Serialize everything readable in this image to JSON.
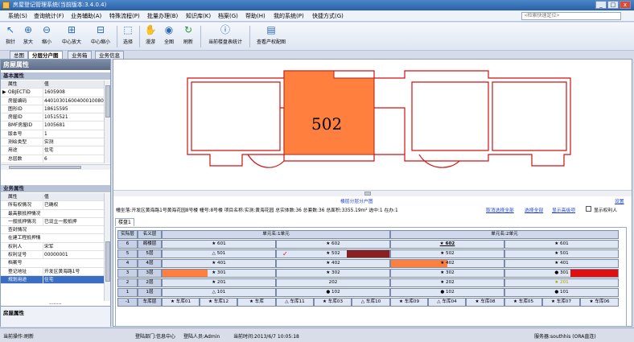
{
  "window": {
    "title": "房屋登记管理系统(当前版本:3.4.0.4)",
    "min": "_",
    "max": "□",
    "close": "x"
  },
  "menu": [
    "系统(S)",
    "查询统计(F)",
    "业务辅助(A)",
    "特殊流程(P)",
    "批量办理(B)",
    "知识库(K)",
    "档案(G)",
    "帮助(H)",
    "我的系统(P)",
    "快捷方式(G)"
  ],
  "search": {
    "placeholder": "<检索快速定位>"
  },
  "toolbar": [
    {
      "label": "指针",
      "icon": "pointer-icon",
      "glyph": "↖"
    },
    {
      "label": "放大",
      "icon": "zoom-in-icon",
      "glyph": "⊕"
    },
    {
      "label": "缩小",
      "icon": "zoom-out-icon",
      "glyph": "⊖"
    },
    {
      "label": "中心放大",
      "icon": "center-zoom-in-icon",
      "glyph": "⊞"
    },
    {
      "label": "中心缩小",
      "icon": "center-zoom-out-icon",
      "glyph": "⊟"
    },
    {
      "label": "选择",
      "icon": "select-icon",
      "glyph": "⬚"
    },
    {
      "label": "漫游",
      "icon": "pan-hand-icon",
      "glyph": "✋"
    },
    {
      "label": "全图",
      "icon": "full-extent-icon",
      "glyph": "◉"
    },
    {
      "label": "刷新",
      "icon": "refresh-icon",
      "glyph": "↻"
    },
    {
      "label": "当前楼盘表统计",
      "icon": "info-icon",
      "glyph": "ⓘ"
    },
    {
      "label": "查看产权配图",
      "icon": "map-icon",
      "glyph": "▤"
    }
  ],
  "tabs": [
    "总图",
    "分层分户图",
    "业务箱",
    "业务信息"
  ],
  "left": {
    "title": "房屋属性",
    "basic_section": "基本属性",
    "basic_header": {
      "k": "属性",
      "v": "值"
    },
    "basic_rows": [
      {
        "k": "OBJECTID",
        "v": "1605908"
      },
      {
        "k": "房屋编码",
        "v": "440103016004000100800"
      },
      {
        "k": "图形ID",
        "v": "18615595"
      },
      {
        "k": "房屋ID",
        "v": "10515521"
      },
      {
        "k": "BMF房屋ID",
        "v": "1005681"
      },
      {
        "k": "版本号",
        "v": "1"
      },
      {
        "k": "测绘类型",
        "v": "实测"
      },
      {
        "k": "用途",
        "v": "住宅"
      },
      {
        "k": "总层数",
        "v": "6"
      }
    ],
    "biz_section": "业务属性",
    "biz_header": {
      "k": "属性",
      "v": "值"
    },
    "biz_rows": [
      {
        "k": "所有权情况",
        "v": "已确权"
      },
      {
        "k": "最高额抵押情况",
        "v": ""
      },
      {
        "k": "一般抵押情况",
        "v": "已设立一般抵押"
      },
      {
        "k": "查封情况",
        "v": ""
      },
      {
        "k": "在建工程抵押情",
        "v": ""
      },
      {
        "k": "权利人",
        "v": "宋军"
      },
      {
        "k": "权利证号",
        "v": "00000001"
      },
      {
        "k": "档案号",
        "v": ""
      },
      {
        "k": "登记地址",
        "v": "开发区黄海路1号"
      },
      {
        "k": "规划用途",
        "v": "住宅"
      }
    ],
    "footer": "房屋属性",
    "dots": "........"
  },
  "plan": {
    "room_label": "502"
  },
  "info": {
    "title": "楼层分层分户图",
    "settings": "设置",
    "summary": "幢坐落:开发区黄海路1号黄海花园8号楼   幢号:8号楼   项目名称:实测:黄海花园  总实体数:36  总套数:36  总面积:3355.19m²  选中:1  在办:1",
    "links": [
      "取消选择全部",
      "选择全部",
      "显示高级项"
    ],
    "checkbox": "显示权利人",
    "sheet_tab": "楼盘1"
  },
  "table": {
    "col_floor": "实际层",
    "col_name": "名义层",
    "unit1": "单元名:1单元",
    "unit2": "单元名:2单元",
    "rows": [
      {
        "f": "6",
        "n": "阁楼层",
        "c": [
          "★ 601",
          "★ 602",
          "★ 602",
          "★ 601"
        ]
      },
      {
        "f": "5",
        "n": "5层",
        "c": [
          "△ 501",
          "★ 502",
          "★ 502",
          "★ 501"
        ]
      },
      {
        "f": "4",
        "n": "4层",
        "c": [
          "★ 401",
          "★ 402",
          "★ 402",
          "★ 401"
        ]
      },
      {
        "f": "3",
        "n": "3层",
        "c": [
          "★ 301",
          "★ 302",
          "★ 302",
          "● 301"
        ]
      },
      {
        "f": "2",
        "n": "2层",
        "c": [
          "★ 201",
          "202",
          "★ 202",
          "★ 201"
        ]
      },
      {
        "f": "1",
        "n": "1层",
        "c": [
          "△ 101",
          "● 102",
          "● 102",
          "● 101"
        ]
      },
      {
        "f": "-1",
        "n": "车库层",
        "c": [
          "★ 车库01",
          "★ 车库12",
          "★ 车库",
          "△ 车库11",
          "★ 车库03",
          "△ 车库10",
          "★ 车库09",
          "△ 车库04",
          "★ 车库08",
          "★ 车库05",
          "★ 车库07",
          "★ 车库06"
        ]
      }
    ]
  },
  "status": {
    "s1": "当前操作:刷新",
    "s2": "登陆部门:信息中心",
    "s3": "登陆人员:Admin",
    "s4": "当前时间:2013/6/7 10:05:18",
    "s5": "服务器:southhis (ORA直连)"
  },
  "colors": {
    "selected": "#ff7f3f",
    "dark_red": "#8b2020",
    "red": "#e01010",
    "yellow": "#f0f020",
    "plan_line": "#d01010"
  }
}
